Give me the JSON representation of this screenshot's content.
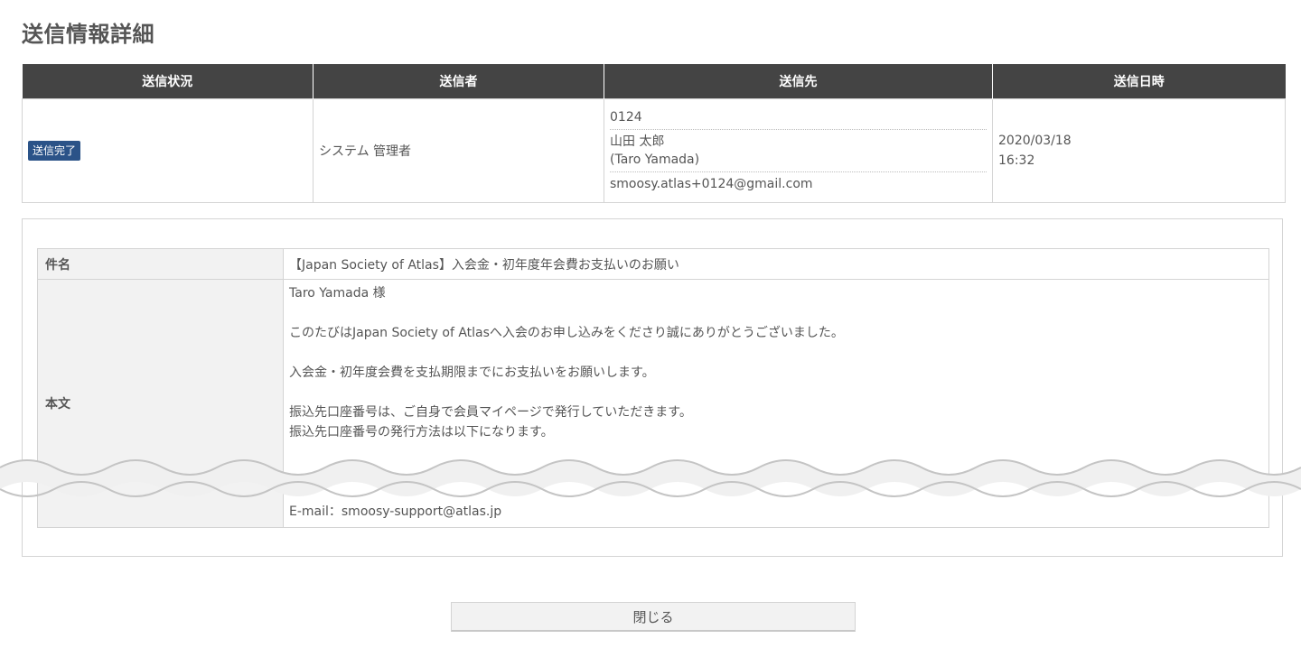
{
  "page_title": "送信情報詳細",
  "summary": {
    "headers": [
      "送信状況",
      "送信者",
      "送信先",
      "送信日時"
    ],
    "status_badge": "送信完了",
    "sender": "システム 管理者",
    "destination": {
      "member_no": "0124",
      "name_ja": "山田 太郎",
      "name_en": "(Taro Yamada)",
      "email": "smoosy.atlas+0124@gmail.com"
    },
    "sent_date": "2020/03/18",
    "sent_time": "16:32"
  },
  "detail": {
    "subject_label": "件名",
    "subject_value": "【Japan Society of Atlas】入会金・初年度年会費お支払いのお願い",
    "body_label": "本文",
    "body_lines": [
      "Taro Yamada 様",
      "",
      "このたびはJapan Society of Atlasへ入会のお申し込みをくださり誠にありがとうございました。",
      "",
      "入会金・初年度会費を支払期限までにお支払いをお願いします。",
      "",
      "振込先口座番号は、ご自身で会員マイページで発行していただきます。",
      "振込先口座番号の発行方法は以下になります。"
    ],
    "body_footer": "E-mail：smoosy-support@atlas.jp"
  },
  "close_button": "閉じる",
  "colors": {
    "header_bg": "#444444",
    "badge_bg": "#2b5388",
    "label_bg": "#f2f2f2",
    "border": "#d4d4d4"
  }
}
